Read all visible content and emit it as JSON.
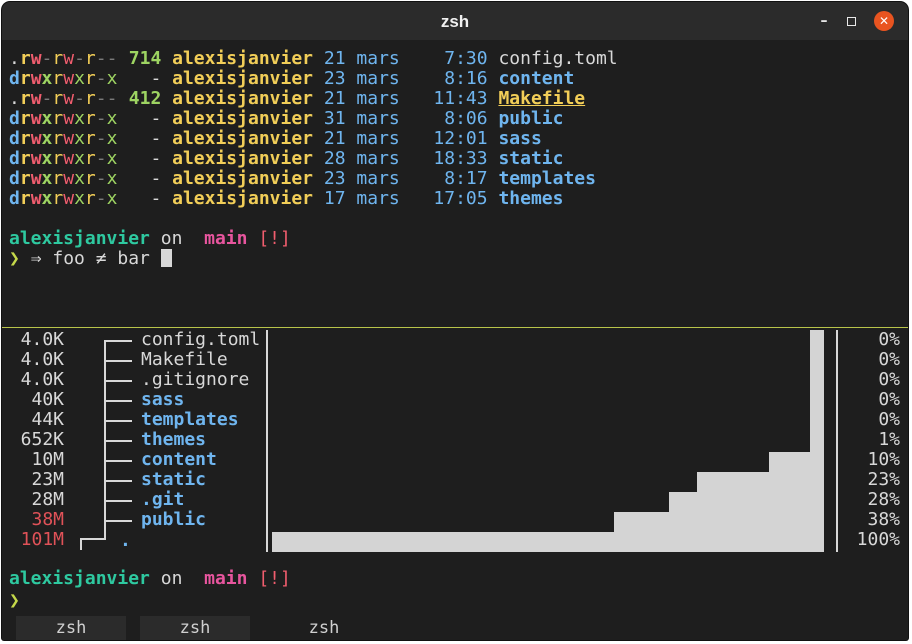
{
  "window": {
    "title": "zsh",
    "minimize": "–",
    "close": "✕"
  },
  "listing": [
    {
      "t": ".",
      "p": [
        "r",
        "w",
        "-",
        "r",
        "w",
        "-",
        "r",
        "-",
        "-"
      ],
      "size": "714",
      "user": "alexisjanvier",
      "day": "21",
      "month": "mars",
      "time": "7:30",
      "name": "config.toml",
      "kind": "file"
    },
    {
      "t": "d",
      "p": [
        "r",
        "w",
        "x",
        "r",
        "w",
        "x",
        "r",
        "-",
        "x"
      ],
      "size": "-",
      "user": "alexisjanvier",
      "day": "23",
      "month": "mars",
      "time": "8:16",
      "name": "content",
      "kind": "dir"
    },
    {
      "t": ".",
      "p": [
        "r",
        "w",
        "-",
        "r",
        "w",
        "-",
        "r",
        "-",
        "-"
      ],
      "size": "412",
      "user": "alexisjanvier",
      "day": "21",
      "month": "mars",
      "time": "11:43",
      "name": "Makefile",
      "kind": "make"
    },
    {
      "t": "d",
      "p": [
        "r",
        "w",
        "x",
        "r",
        "w",
        "x",
        "r",
        "-",
        "x"
      ],
      "size": "-",
      "user": "alexisjanvier",
      "day": "31",
      "month": "mars",
      "time": "8:06",
      "name": "public",
      "kind": "dir"
    },
    {
      "t": "d",
      "p": [
        "r",
        "w",
        "x",
        "r",
        "w",
        "x",
        "r",
        "-",
        "x"
      ],
      "size": "-",
      "user": "alexisjanvier",
      "day": "21",
      "month": "mars",
      "time": "12:01",
      "name": "sass",
      "kind": "dir"
    },
    {
      "t": "d",
      "p": [
        "r",
        "w",
        "x",
        "r",
        "w",
        "x",
        "r",
        "-",
        "x"
      ],
      "size": "-",
      "user": "alexisjanvier",
      "day": "28",
      "month": "mars",
      "time": "18:33",
      "name": "static",
      "kind": "dir"
    },
    {
      "t": "d",
      "p": [
        "r",
        "w",
        "x",
        "r",
        "w",
        "x",
        "r",
        "-",
        "x"
      ],
      "size": "-",
      "user": "alexisjanvier",
      "day": "23",
      "month": "mars",
      "time": "8:17",
      "name": "templates",
      "kind": "dir"
    },
    {
      "t": "d",
      "p": [
        "r",
        "w",
        "x",
        "r",
        "w",
        "x",
        "r",
        "-",
        "x"
      ],
      "size": "-",
      "user": "alexisjanvier",
      "day": "17",
      "month": "mars",
      "time": "17:05",
      "name": "themes",
      "kind": "dir"
    }
  ],
  "prompt1": {
    "user": "alexisjanvier",
    "on": "on",
    "branch_icon": "",
    "branch": "main",
    "status": "[!]",
    "arrow": "❯",
    "command": "⇒ foo ≠ bar"
  },
  "du": [
    {
      "size": "4.0K",
      "name": "config.toml",
      "dir": false,
      "pct": "0%",
      "fraction": 0.0,
      "red": false
    },
    {
      "size": "4.0K",
      "name": "Makefile",
      "dir": false,
      "pct": "0%",
      "fraction": 0.0,
      "red": false
    },
    {
      "size": "4.0K",
      "name": ".gitignore",
      "dir": false,
      "pct": "0%",
      "fraction": 0.0,
      "red": false
    },
    {
      "size": "40K",
      "name": "sass",
      "dir": true,
      "pct": "0%",
      "fraction": 0.0,
      "red": false
    },
    {
      "size": "44K",
      "name": "templates",
      "dir": true,
      "pct": "0%",
      "fraction": 0.0,
      "red": false
    },
    {
      "size": "652K",
      "name": "themes",
      "dir": true,
      "pct": "1%",
      "fraction": 0.01,
      "red": false
    },
    {
      "size": "10M",
      "name": "content",
      "dir": true,
      "pct": "10%",
      "fraction": 0.1,
      "red": false
    },
    {
      "size": "23M",
      "name": "static",
      "dir": true,
      "pct": "23%",
      "fraction": 0.23,
      "red": false
    },
    {
      "size": "28M",
      "name": ".git",
      "dir": true,
      "pct": "28%",
      "fraction": 0.28,
      "red": false
    },
    {
      "size": "38M",
      "name": "public",
      "dir": true,
      "pct": "38%",
      "fraction": 0.38,
      "red": true
    },
    {
      "size": "101M",
      "name": ".",
      "dir": true,
      "pct": "100%",
      "fraction": 1.0,
      "red": true
    }
  ],
  "prompt2": {
    "user": "alexisjanvier",
    "on": "on",
    "branch_icon": "",
    "branch": "main",
    "status": "[!]",
    "arrow": "❯"
  },
  "tabs": [
    {
      "label": "zsh",
      "active": false
    },
    {
      "label": "zsh",
      "active": false
    },
    {
      "label": "zsh",
      "active": true
    }
  ],
  "colors": {
    "background": "#1e1e1e",
    "accent_green": "#9ed462",
    "accent_yellow": "#f2ce58",
    "accent_blue": "#6fb5ef",
    "accent_red": "#f05d6e",
    "pink": "#e8559e",
    "separator": "#b8c44a"
  }
}
